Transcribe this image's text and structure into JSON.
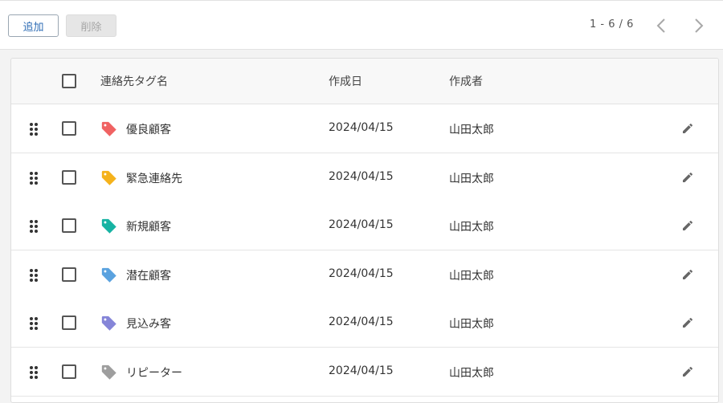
{
  "toolbar": {
    "add_label": "追加",
    "delete_label": "削除",
    "pagination": "1 - 6 / 6"
  },
  "table": {
    "columns": [
      "連絡先タグ名",
      "作成日",
      "作成者"
    ],
    "rows": [
      {
        "name": "優良顧客",
        "date": "2024/04/15",
        "author": "山田太郎",
        "color": "#f06262"
      },
      {
        "name": "緊急連絡先",
        "date": "2024/04/15",
        "author": "山田太郎",
        "color": "#f5b21b"
      },
      {
        "name": "新規顧客",
        "date": "2024/04/15",
        "author": "山田太郎",
        "color": "#17b3a3"
      },
      {
        "name": "潜在顧客",
        "date": "2024/04/15",
        "author": "山田太郎",
        "color": "#5aa2df"
      },
      {
        "name": "見込み客",
        "date": "2024/04/15",
        "author": "山田太郎",
        "color": "#8585d8"
      },
      {
        "name": "リピーター",
        "date": "2024/04/15",
        "author": "山田太郎",
        "color": "#9e9e9e"
      }
    ]
  },
  "icons": {
    "drag": "drag-handle-icon",
    "tag": "tag-icon",
    "edit": "pencil-icon",
    "prev": "chevron-left-icon",
    "next": "chevron-right-icon"
  }
}
